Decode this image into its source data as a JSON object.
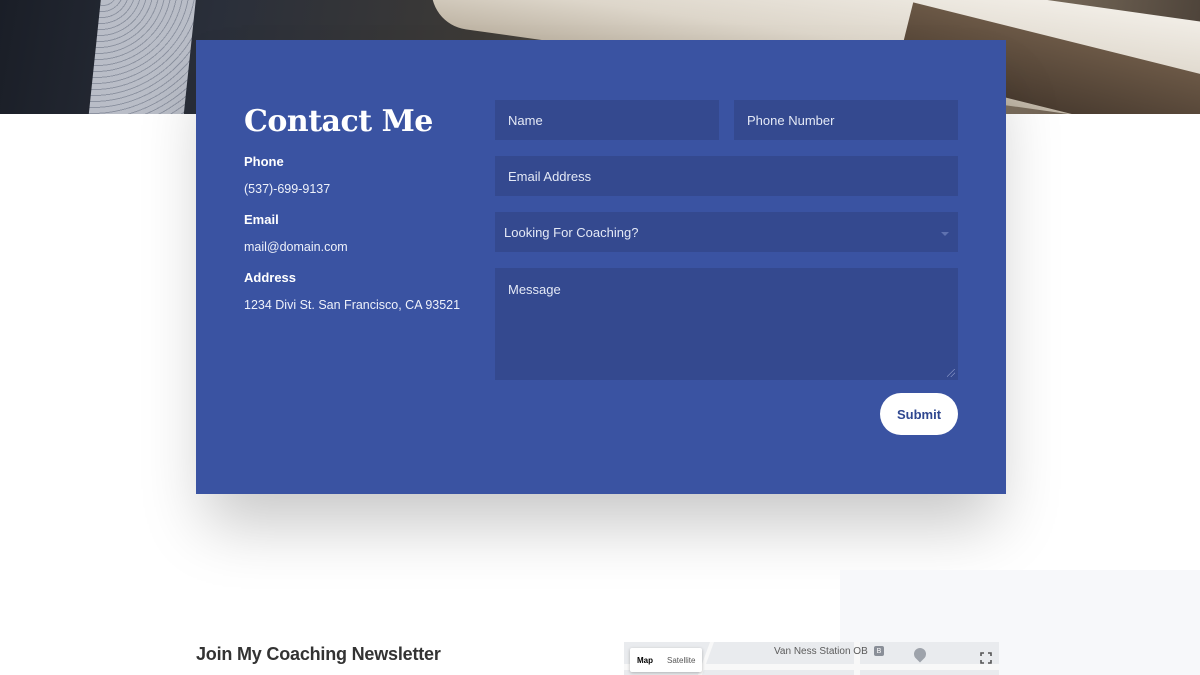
{
  "contact": {
    "title": "Contact Me",
    "phone_label": "Phone",
    "phone_value": "(537)-699-9137",
    "email_label": "Email",
    "email_value": "mail@domain.com",
    "address_label": "Address",
    "address_value": "1234 Divi St. San Francisco, CA 93521"
  },
  "form": {
    "name_placeholder": "Name",
    "phone_placeholder": "Phone Number",
    "email_placeholder": "Email Address",
    "select_value": "Looking For Coaching?",
    "message_placeholder": "Message",
    "submit_label": "Submit"
  },
  "newsletter": {
    "heading": "Join My Coaching Newsletter"
  },
  "map": {
    "map_tab": "Map",
    "satellite_tab": "Satellite",
    "station_label": "Van Ness Station OB",
    "station_icon_text": "B"
  },
  "colors": {
    "card_bg": "#3a53a2",
    "field_bg": "#34498f",
    "submit_text": "#2f4790"
  }
}
